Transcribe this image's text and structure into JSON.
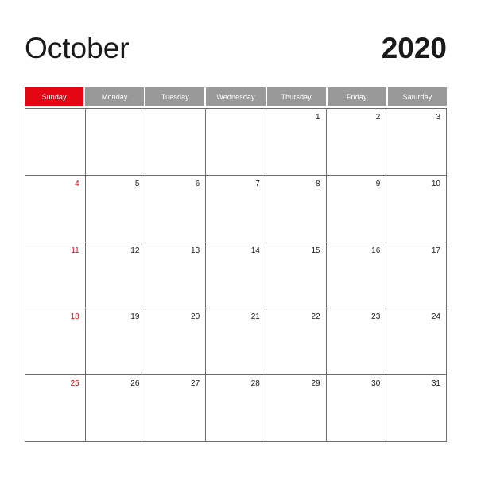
{
  "calendar": {
    "month": "October",
    "year": "2020",
    "colors": {
      "accent_red": "#E30613",
      "header_gray": "#999999",
      "grid_line": "#6E6E6E",
      "text": "#1A1A1A",
      "background": "#FFFFFF"
    },
    "weekdays": [
      {
        "label": "Sunday",
        "highlight": true
      },
      {
        "label": "Monday",
        "highlight": false
      },
      {
        "label": "Tuesday",
        "highlight": false
      },
      {
        "label": "Wednesday",
        "highlight": false
      },
      {
        "label": "Thursday",
        "highlight": false
      },
      {
        "label": "Friday",
        "highlight": false
      },
      {
        "label": "Saturday",
        "highlight": false
      }
    ],
    "weeks": [
      [
        {
          "day": "",
          "sunday": true
        },
        {
          "day": "",
          "sunday": false
        },
        {
          "day": "",
          "sunday": false
        },
        {
          "day": "",
          "sunday": false
        },
        {
          "day": "1",
          "sunday": false
        },
        {
          "day": "2",
          "sunday": false
        },
        {
          "day": "3",
          "sunday": false
        }
      ],
      [
        {
          "day": "4",
          "sunday": true
        },
        {
          "day": "5",
          "sunday": false
        },
        {
          "day": "6",
          "sunday": false
        },
        {
          "day": "7",
          "sunday": false
        },
        {
          "day": "8",
          "sunday": false
        },
        {
          "day": "9",
          "sunday": false
        },
        {
          "day": "10",
          "sunday": false
        }
      ],
      [
        {
          "day": "11",
          "sunday": true
        },
        {
          "day": "12",
          "sunday": false
        },
        {
          "day": "13",
          "sunday": false
        },
        {
          "day": "14",
          "sunday": false
        },
        {
          "day": "15",
          "sunday": false
        },
        {
          "day": "16",
          "sunday": false
        },
        {
          "day": "17",
          "sunday": false
        }
      ],
      [
        {
          "day": "18",
          "sunday": true
        },
        {
          "day": "19",
          "sunday": false
        },
        {
          "day": "20",
          "sunday": false
        },
        {
          "day": "21",
          "sunday": false
        },
        {
          "day": "22",
          "sunday": false
        },
        {
          "day": "23",
          "sunday": false
        },
        {
          "day": "24",
          "sunday": false
        }
      ],
      [
        {
          "day": "25",
          "sunday": true
        },
        {
          "day": "26",
          "sunday": false
        },
        {
          "day": "27",
          "sunday": false
        },
        {
          "day": "28",
          "sunday": false
        },
        {
          "day": "29",
          "sunday": false
        },
        {
          "day": "30",
          "sunday": false
        },
        {
          "day": "31",
          "sunday": false
        }
      ]
    ]
  }
}
